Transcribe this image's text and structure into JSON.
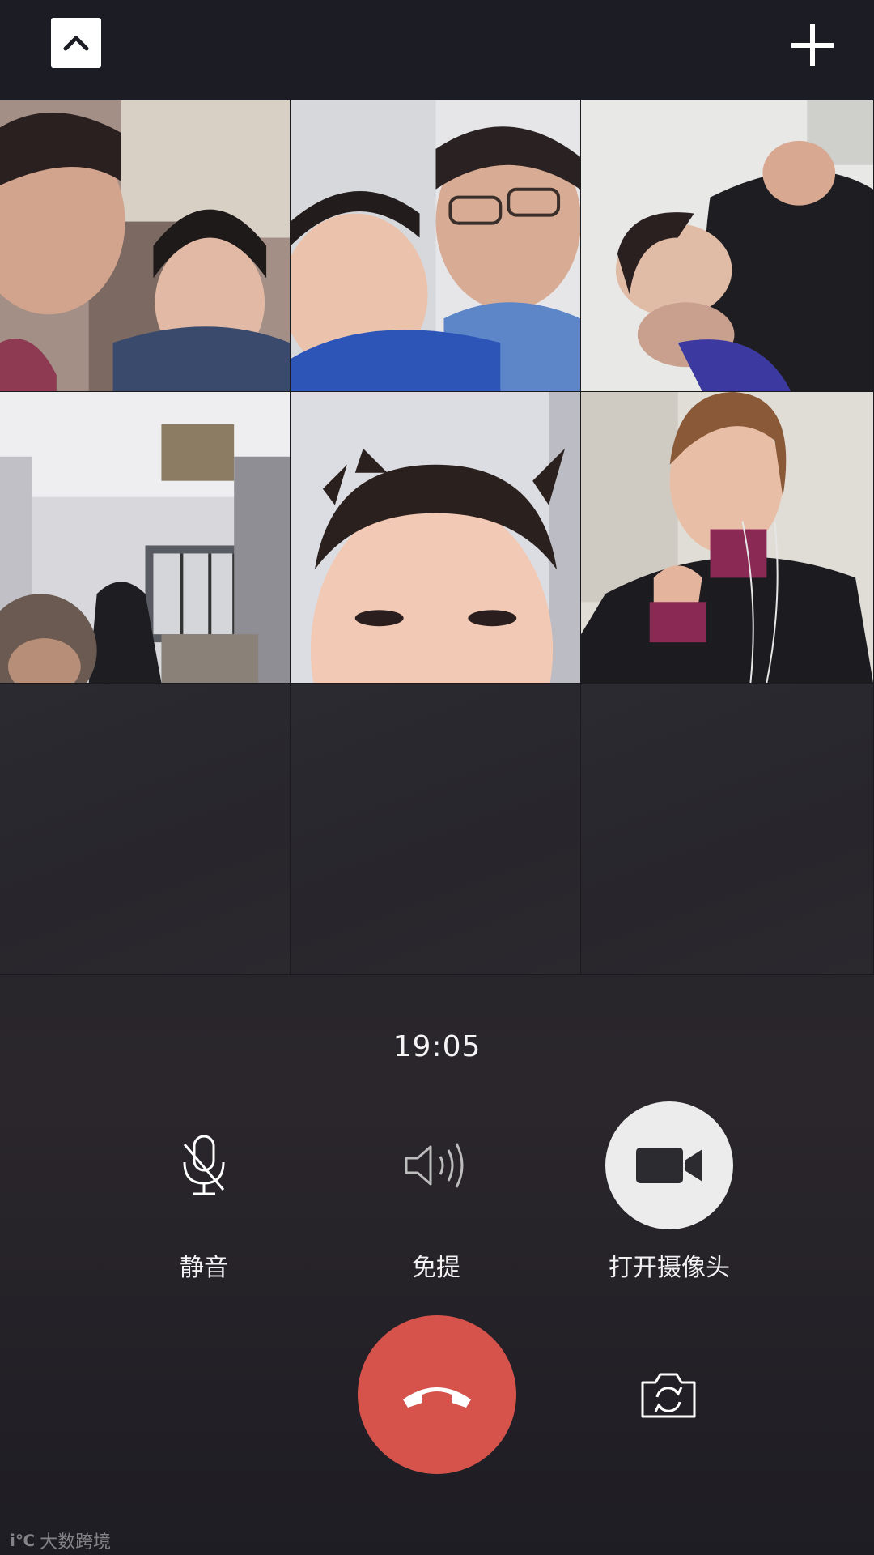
{
  "call": {
    "duration": "19:05"
  },
  "header": {
    "minimize_icon": "chevron-up-icon",
    "add_icon": "plus-icon"
  },
  "participants": [
    {
      "state": "video"
    },
    {
      "state": "video"
    },
    {
      "state": "video"
    },
    {
      "state": "video"
    },
    {
      "state": "video"
    },
    {
      "state": "video"
    },
    {
      "state": "empty"
    },
    {
      "state": "empty"
    },
    {
      "state": "empty"
    }
  ],
  "controls": {
    "mute_label": "静音",
    "speaker_label": "免提",
    "camera_label": "打开摄像头"
  },
  "actions": {
    "hangup_icon": "phone-hangup-icon",
    "switch_camera_icon": "camera-switch-icon"
  },
  "watermark": {
    "text": "大数跨境",
    "logo": "i℃"
  },
  "colors": {
    "background": "#1e1e24",
    "hangup": "#d6534c",
    "camera_button": "#ececec",
    "text": "#ffffff"
  }
}
